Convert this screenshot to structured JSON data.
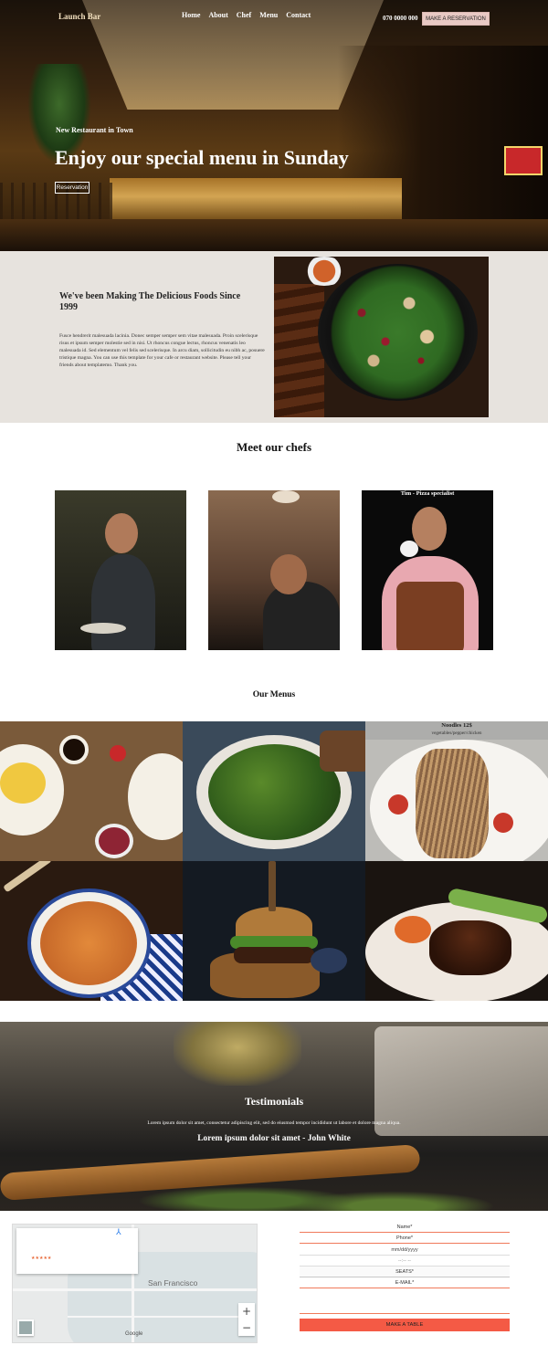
{
  "nav": {
    "brand": "Launch Bar",
    "links": [
      "Home",
      "About",
      "Chef",
      "Menu",
      "Contact"
    ],
    "phone": "070 0000 000",
    "reserve_label": "MAKE A RESERVATION"
  },
  "hero": {
    "kicker": "New Restaurant in Town",
    "title": "Enjoy our special menu in Sunday",
    "button_label": "Reservation"
  },
  "about": {
    "title": "We've been Making The Delicious Foods Since 1999",
    "text": "Fusce hendrerit malesuada lacinia. Donec semper semper sem vitae malesuada. Proin scelerisque risus et ipsum semper molestie sed in nisi. Ut rhoncus congue lectus, rhoncus venenatis leo malesuada id. Sed elementum vel felis sed scelerisque. In arcu diam, sollicitudin eu nibh ac, posuere tristique magna. You can use this template for your cafe or restaurant website. Please tell your friends about templatemo. Thank you."
  },
  "chefs": {
    "title": "Meet our chefs",
    "items": [
      {
        "caption": ""
      },
      {
        "caption": ""
      },
      {
        "caption": "Tim - Pizza specialist"
      }
    ]
  },
  "menus": {
    "title": "Our Menus",
    "items": [
      {
        "name": "",
        "desc": ""
      },
      {
        "name": "",
        "desc": ""
      },
      {
        "name": "Noodles 12$",
        "desc": "vegetables/pepper/chicken"
      },
      {
        "name": "",
        "desc": ""
      },
      {
        "name": "",
        "desc": ""
      },
      {
        "name": "",
        "desc": ""
      }
    ]
  },
  "testimonials": {
    "title": "Testimonials",
    "text": "Lorem ipsum dolor sit amet, consectetur adipiscing elit, sed do eiusmod tempor incididunt ut labore et dolore magna aliqua.",
    "author": "Lorem ipsum dolor sit amet - John White"
  },
  "map": {
    "city_label": "San Francisco",
    "stars": "★★★★★",
    "logo": "Google",
    "zoom_in": "+",
    "zoom_out": "−"
  },
  "form": {
    "name_placeholder": "Name*",
    "phone_placeholder": "Phone*",
    "date_value": "mm/dd/yyyy",
    "time_value": "--:-- --",
    "seats_value": "SEATS*",
    "email_placeholder": "E-MAIL*",
    "submit_label": "MAKE A TABLE"
  },
  "colors": {
    "accent": "#f45a45",
    "about_bg": "#e7e3de",
    "reserve_bg": "#e8c9c4"
  }
}
